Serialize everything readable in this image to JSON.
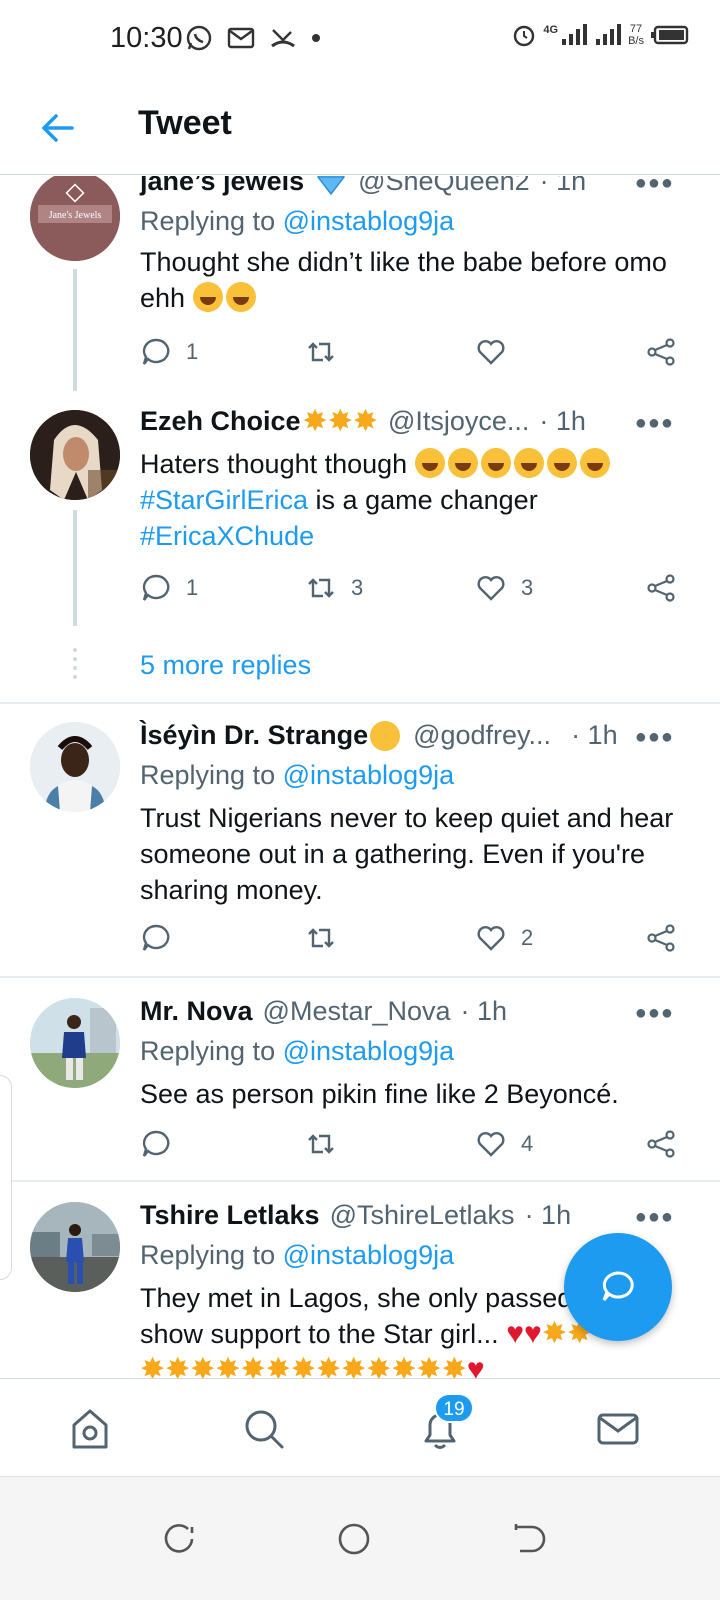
{
  "status_bar": {
    "time": "10:30",
    "network": "4G",
    "speed_value": "77",
    "speed_unit": "B/s"
  },
  "header": {
    "title": "Tweet"
  },
  "tweets": [
    {
      "name": "jane’s jewels",
      "handle": "@SheQueen2",
      "time": "· 1h",
      "replying_prefix": "Replying to ",
      "replying_to": "@instablog9ja",
      "text": "Thought she didn’t like the babe before omo ehh",
      "replies": "1",
      "retweets": "",
      "likes": ""
    },
    {
      "name": "Ezeh Choice",
      "handle": "@Itsjoyce...",
      "time": "· 1h",
      "text_line1": "Haters thought though",
      "tag1": "#StarGirlErica",
      "text_after_tag1": " is a game changer",
      "tag2": "#EricaXChude",
      "replies": "1",
      "retweets": "3",
      "likes": "3"
    },
    {
      "name": "Ìséyìn Dr. Strange",
      "handle": "@godfrey...",
      "time": "· 1h",
      "replying_prefix": "Replying to ",
      "replying_to": "@instablog9ja",
      "text": "Trust Nigerians never to keep quiet and hear someone out in a gathering. Even if you're sharing money.",
      "replies": "",
      "retweets": "",
      "likes": "2"
    },
    {
      "name": "Mr. Nova",
      "handle": "@Mestar_Nova",
      "time": "· 1h",
      "replying_prefix": "Replying to ",
      "replying_to": "@instablog9ja",
      "text": "See as person pikin fine like 2 Beyoncé.",
      "replies": "",
      "retweets": "",
      "likes": "4"
    },
    {
      "name": "Tshire Letlaks",
      "handle": "@TshireLetlaks",
      "time": "· 1h",
      "replying_prefix": "Replying to ",
      "replying_to": "@instablog9ja",
      "text_line1": "They met in Lagos, she only passed",
      "text_line2": "show support to the Star girl..."
    }
  ],
  "more_replies": "5 more replies",
  "avatar_logo_text": "Jane's Jewels",
  "bottom_nav": {
    "items": [
      "home-icon",
      "search-icon",
      "notifications-icon",
      "messages-icon"
    ],
    "notification_count": "19"
  },
  "colors": {
    "accent": "#1d9bf0",
    "text": "#0f1419",
    "secondary": "#536471"
  }
}
